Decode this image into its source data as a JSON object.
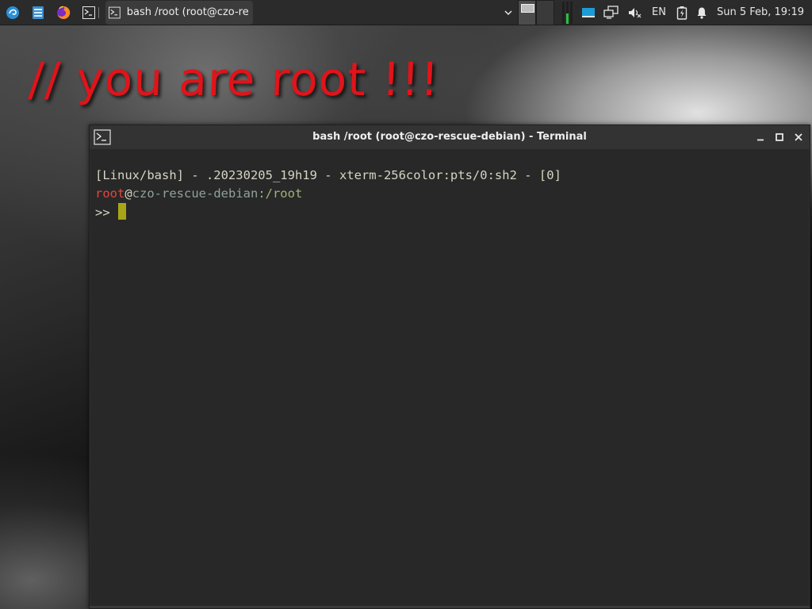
{
  "desktop": {
    "banner_text": "// you are root !!!"
  },
  "panel": {
    "launchers": [
      {
        "name": "debian-menu-icon"
      },
      {
        "name": "file-manager-icon"
      },
      {
        "name": "firefox-icon"
      },
      {
        "name": "terminal-launcher-icon"
      }
    ],
    "task": {
      "label": "bash /root (root@czo-re..."
    },
    "language": "EN",
    "clock": "Sun  5 Feb, 19:19",
    "cpu_usage": [
      0.0,
      0.45,
      0.0
    ]
  },
  "terminal": {
    "title": "bash /root (root@czo-rescue-debian) - Terminal",
    "lines": {
      "status": "[Linux/bash] - .20230205_19h19 - xterm-256color:pts/0:sh2 - [0]",
      "user": "root",
      "at": "@",
      "host": "czo-rescue-debian",
      "path": ":/root",
      "prompt": ">> "
    }
  },
  "colors": {
    "banner": "#e0141a",
    "panel_bg": "#2b2b2b",
    "terminal_bg": "#282828",
    "prompt_user": "#e8453c",
    "prompt_host": "#8fa29a",
    "prompt_path": "#9fb478",
    "cursor": "#a8a519"
  }
}
